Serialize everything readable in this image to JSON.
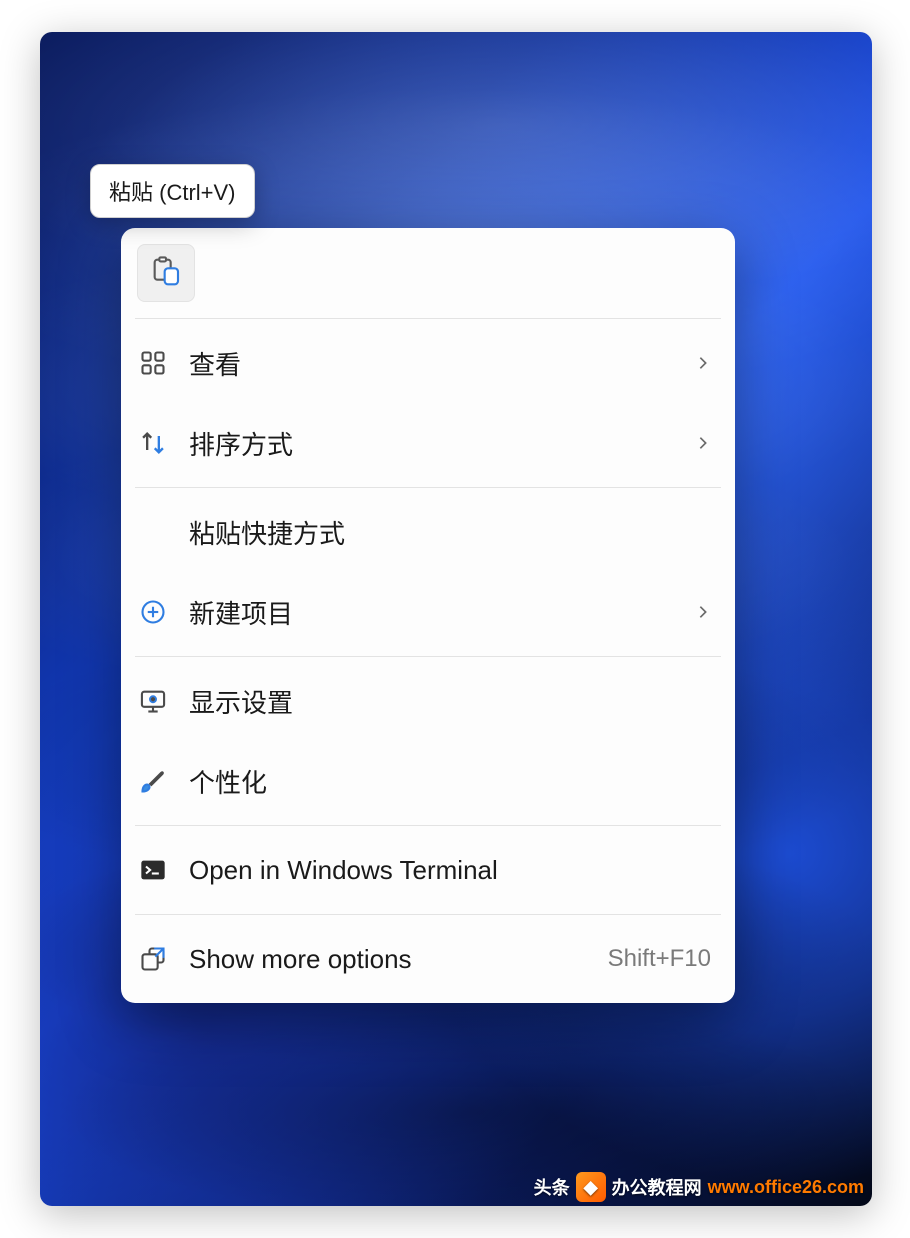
{
  "tooltip": {
    "text": "粘贴 (Ctrl+V)"
  },
  "toolbar": {
    "paste_icon": "paste"
  },
  "menu": {
    "view": {
      "label": "查看",
      "has_submenu": true
    },
    "sort": {
      "label": "排序方式",
      "has_submenu": true
    },
    "paste_shortcut": {
      "label": "粘贴快捷方式",
      "has_submenu": false
    },
    "new_item": {
      "label": "新建项目",
      "has_submenu": true
    },
    "display_settings": {
      "label": "显示设置",
      "has_submenu": false
    },
    "personalize": {
      "label": "个性化",
      "has_submenu": false
    },
    "terminal": {
      "label": "Open in Windows Terminal",
      "has_submenu": false
    },
    "more_options": {
      "label": "Show more options",
      "shortcut": "Shift+F10",
      "has_submenu": false
    }
  },
  "watermark": {
    "cn_text": "办公教程网",
    "url_text": "www.office26.com"
  }
}
